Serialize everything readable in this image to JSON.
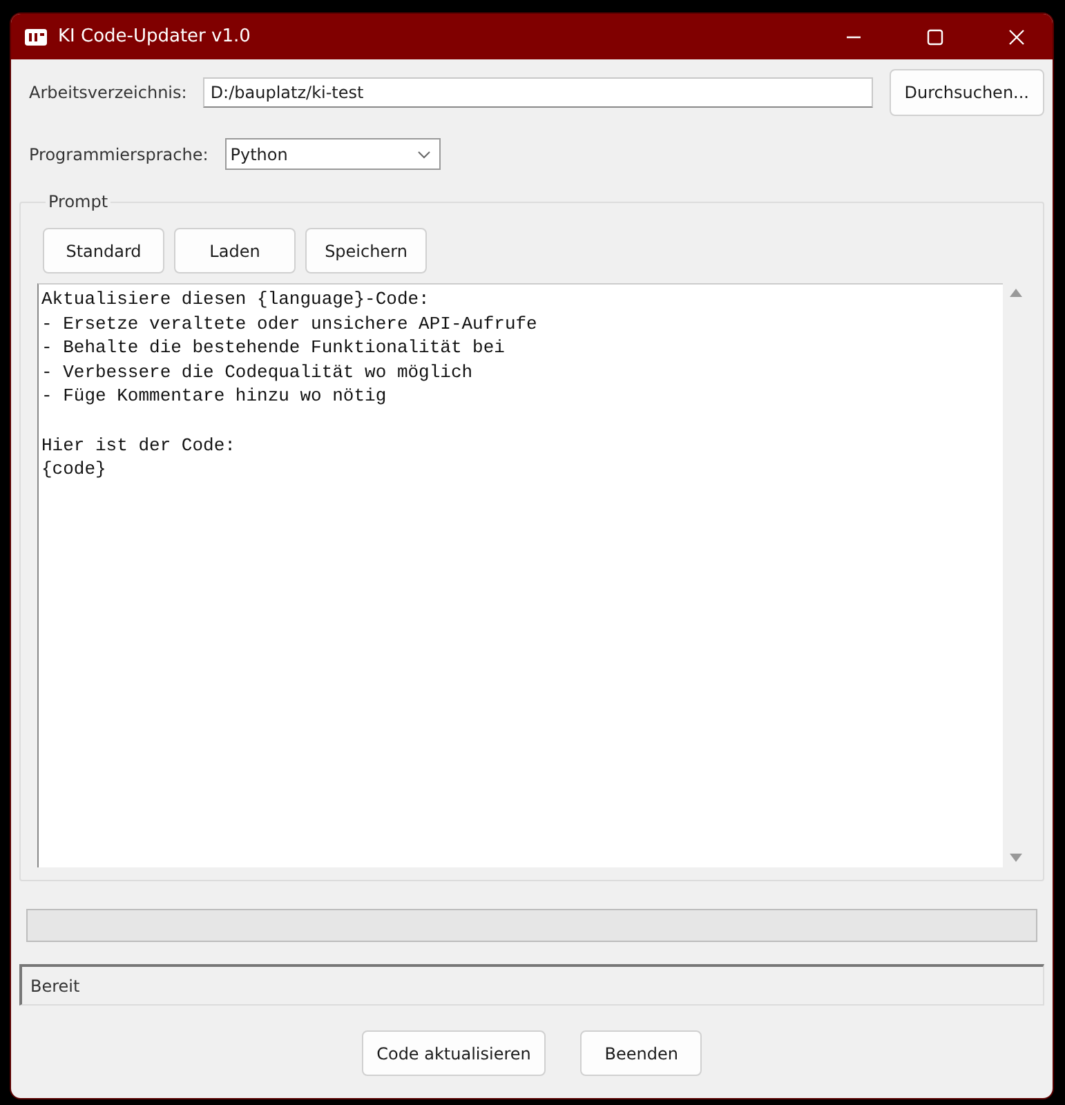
{
  "window": {
    "title": "KI Code-Updater v1.0"
  },
  "directory": {
    "label": "Arbeitsverzeichnis:",
    "value": "D:/bauplatz/ki-test",
    "button": "Durchsuchen..."
  },
  "language": {
    "label": "Programmiersprache:",
    "value": "Python"
  },
  "prompt": {
    "title": "Prompt",
    "buttons": [
      "Standard",
      "Laden",
      "Speichern"
    ],
    "text": "Aktualisiere diesen {language}-Code:\n- Ersetze veraltete oder unsichere API-Aufrufe\n- Behalte die bestehende Funktionalität bei\n- Verbessere die Codequalität wo möglich\n- Füge Kommentare hinzu wo nötig\n\nHier ist der Code:\n{code}"
  },
  "progress": {
    "level": 0
  },
  "status_bar": "Bereit",
  "buttons": [
    "Code aktualisieren",
    "Beenden"
  ]
}
